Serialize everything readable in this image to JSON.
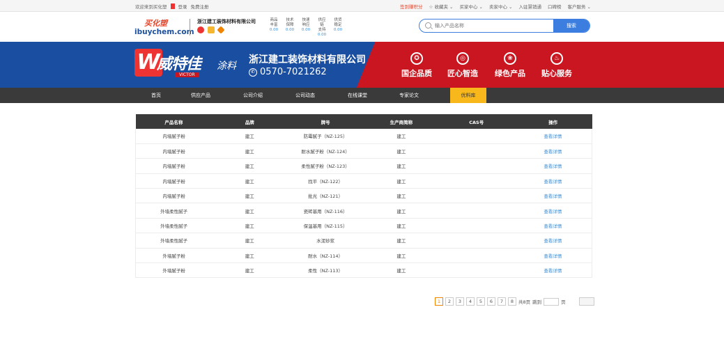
{
  "topbar": {
    "welcome": "欢迎来到买化塑",
    "login": "登录",
    "register": "免费注册",
    "points": "签到赚积分",
    "favorites": "☆ 收藏夹 ⌄",
    "buyer": "买家中心 ⌄",
    "seller": "卖家中心 ⌄",
    "join": "入驻慧销通",
    "app": "口碑榜",
    "service": "客户服务 ⌄"
  },
  "header": {
    "logo_cn": "买化塑",
    "logo_en": "ibuychem.com",
    "company": "浙江建工装饰材料有限公司",
    "stats": [
      {
        "label1": "商品",
        "label2": "丰富",
        "value": "0.00"
      },
      {
        "label1": "技术",
        "label2": "保障",
        "value": "0.00"
      },
      {
        "label1": "快速",
        "label2": "响应",
        "value": "0.00"
      },
      {
        "label1": "供应链",
        "label2": "支持",
        "value": "0.00"
      },
      {
        "label1": "供货",
        "label2": "稳定",
        "value": "0.00"
      }
    ],
    "search_placeholder": "输入产品名称",
    "search_button": "搜索"
  },
  "banner": {
    "brand_cn": "威特佳",
    "brand_en": "VICTOR",
    "brand_tail": "涂料",
    "company": "浙江建工装饰材料有限公司",
    "phone": "0570-7021262",
    "features": [
      "国企品质",
      "匠心智造",
      "绿色产品",
      "贴心服务"
    ]
  },
  "nav": {
    "items": [
      "首页",
      "供应产品",
      "公司介绍",
      "公司动态",
      "在线课堂",
      "专家论文",
      "优料库"
    ],
    "active": 6
  },
  "table": {
    "headers": [
      "产品名称",
      "品牌",
      "牌号",
      "生产商简称",
      "CAS号",
      "操作"
    ],
    "rows": [
      [
        "内墙腻子粉",
        "建工",
        "防霉腻子（NZ-125）",
        "建工",
        "",
        "查看详情"
      ],
      [
        "内墙腻子粉",
        "建工",
        "耐水腻子粉（NZ-124）",
        "建工",
        "",
        "查看详情"
      ],
      [
        "内墙腻子粉",
        "建工",
        "柔性腻子粉（NZ-123）",
        "建工",
        "",
        "查看详情"
      ],
      [
        "内墙腻子粉",
        "建工",
        "找平（NZ-122）",
        "建工",
        "",
        "查看详情"
      ],
      [
        "内墙腻子粉",
        "建工",
        "批光（NZ-121）",
        "建工",
        "",
        "查看详情"
      ],
      [
        "外墙柔性腻子",
        "建工",
        "瓷砖基用（NZ-116）",
        "建工",
        "",
        "查看详情"
      ],
      [
        "外墙柔性腻子",
        "建工",
        "保温基用（NZ-115）",
        "建工",
        "",
        "查看详情"
      ],
      [
        "外墙柔性腻子",
        "建工",
        "水泥砂浆",
        "建工",
        "",
        "查看详情"
      ],
      [
        "外墙腻子粉",
        "建工",
        "耐水（NZ-114）",
        "建工",
        "",
        "查看详情"
      ],
      [
        "外墙腻子粉",
        "建工",
        "柔性（NZ-113）",
        "建工",
        "",
        "查看详情"
      ]
    ]
  },
  "pager": {
    "pages": [
      "1",
      "2",
      "3",
      "4",
      "5",
      "6",
      "7",
      "8"
    ],
    "current": 0,
    "total": "共8页",
    "goto": "跳到",
    "unit": "页"
  },
  "colors": {
    "nav_bg": "#3a3a3a",
    "nav_active": "#f8b81c",
    "link": "#3b8fd6",
    "banner_blue": "#1a4ea0",
    "banner_red": "#c91621"
  }
}
